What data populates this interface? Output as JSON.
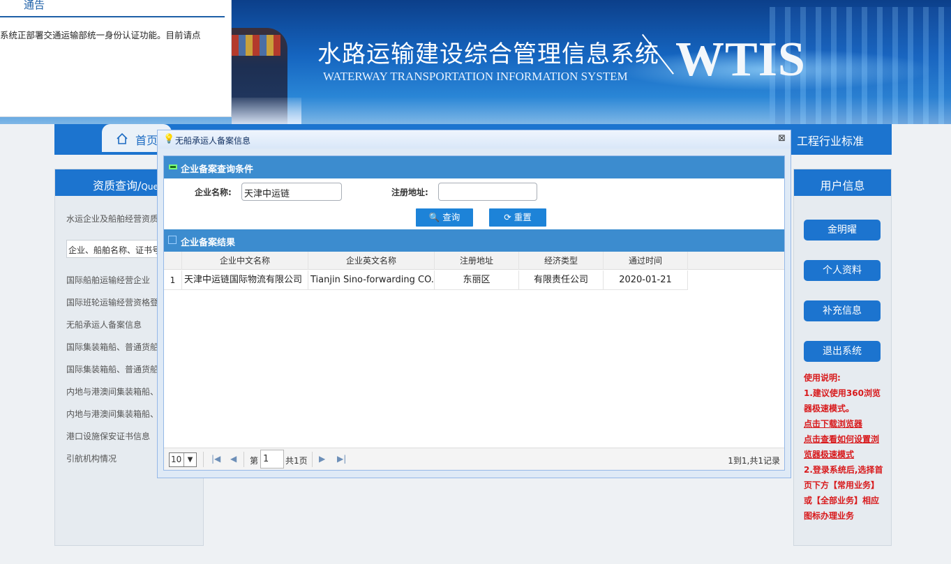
{
  "banner": {
    "title_cn": "水路运输建设综合管理信息系统",
    "title_en": "WATERWAY TRANSPORTATION INFORMATION SYSTEM",
    "logo_text": "WTIS"
  },
  "notice": {
    "title": "通告",
    "text": "系统正部署交通运输部统一身份认证功能。目前请点"
  },
  "nav": {
    "home_label": "首页",
    "right_label": "工程行业标准"
  },
  "left_panel": {
    "title": "资质查询/",
    "title_suffix": "Que",
    "intro": "水运企业及船舶经营资质",
    "search_placeholder": "企业、船舶名称、证书号",
    "items": [
      "国际船舶运输经营企业",
      "国际班轮运输经营资格登",
      "无船承运人备案信息",
      "国际集装箱船、普通货船",
      "国际集装箱船、普通货船",
      "内地与港澳间集装箱船、",
      "内地与港澳间集装箱船、",
      "港口设施保安证书信息",
      "引航机构情况"
    ]
  },
  "right_panel": {
    "title": "用户信息",
    "buttons": [
      "金明曜",
      "个人资料",
      "补充信息",
      "退出系统"
    ],
    "notes": {
      "heading": "使用说明:",
      "line1": "1.建议使用360浏览器极速模式。",
      "link1": "点击下载浏览器",
      "link2": "点击查看如何设置浏览器极速模式",
      "line2": "2.登录系统后,选择首页下方【常用业务】或【全部业务】相应图标办理业务"
    }
  },
  "dialog": {
    "title": "无船承运人备案信息",
    "query_section": "企业备案查询条件",
    "company_label": "企业名称:",
    "company_value": "天津中运链",
    "address_label": "注册地址:",
    "address_value": "",
    "search_button": "查询",
    "reset_button": "重置",
    "result_section": "企业备案结果",
    "columns": [
      "企业中文名称",
      "企业英文名称",
      "注册地址",
      "经济类型",
      "通过时间"
    ],
    "rows": [
      {
        "index": "1",
        "name_cn": "天津中运链国际物流有限公司",
        "name_en": "Tianjin Sino-forwarding CO.,",
        "address": "东丽区",
        "type": "有限责任公司",
        "date": "2020-01-21"
      }
    ],
    "pager": {
      "page_size": "10",
      "page_prefix": "第",
      "page_value": "1",
      "page_total": "共1页",
      "info": "1到1,共1记录"
    }
  }
}
